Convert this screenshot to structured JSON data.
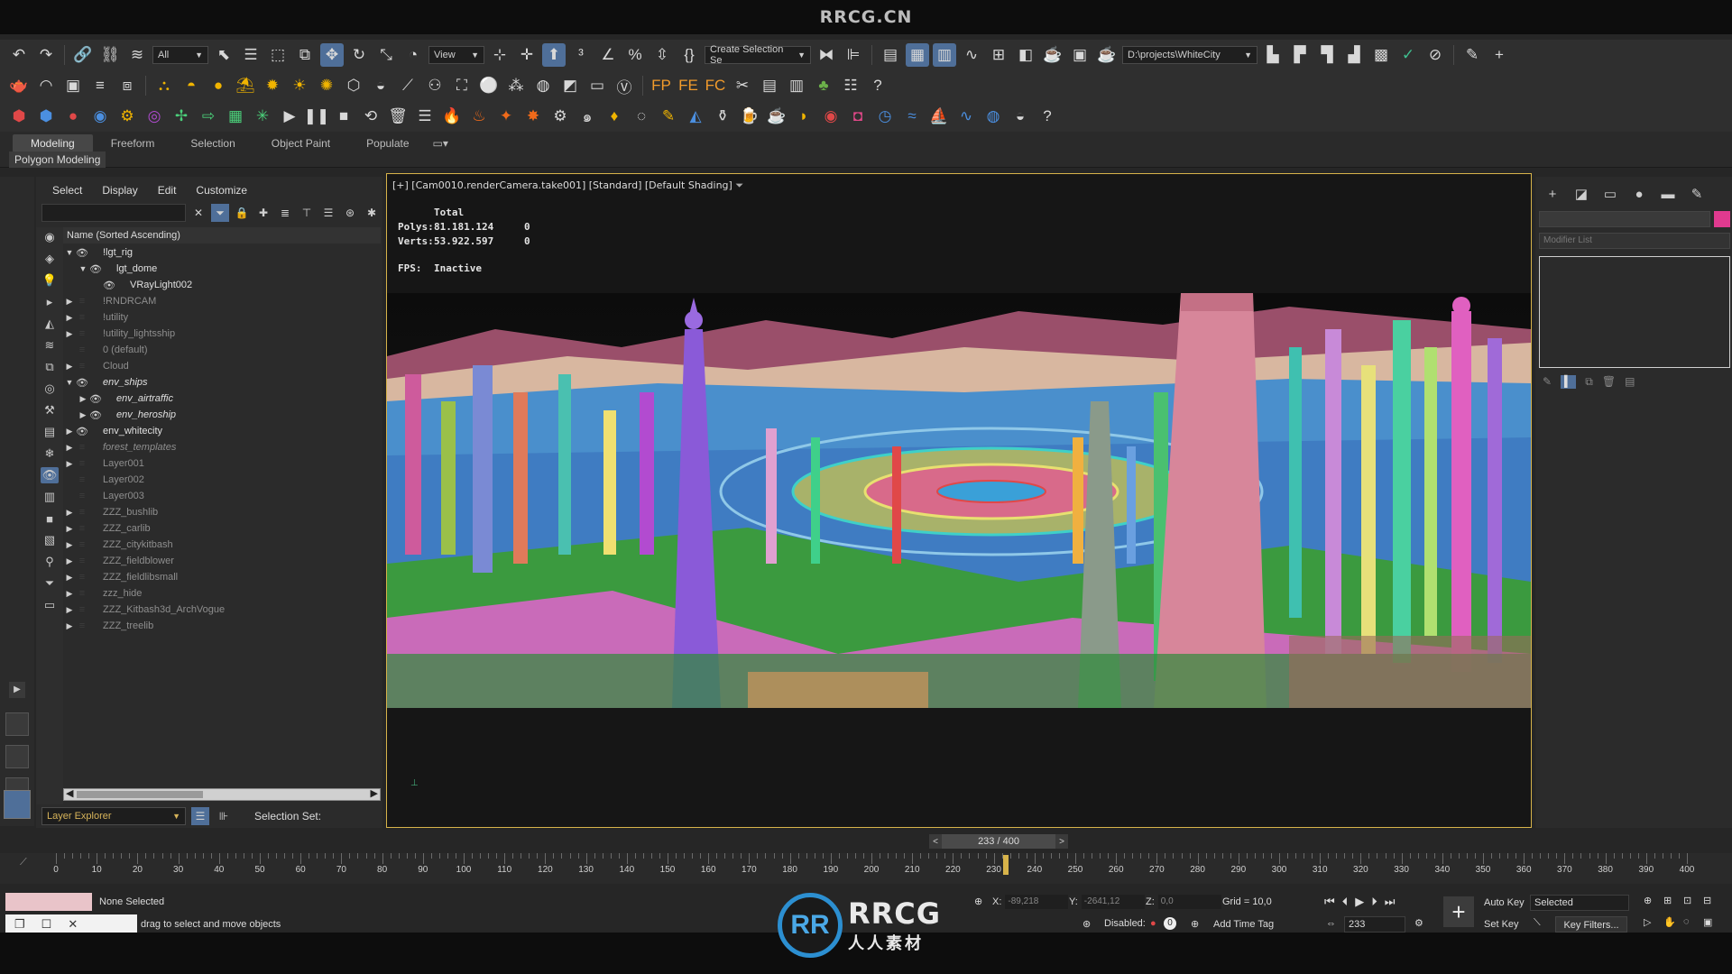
{
  "watermark": {
    "top": "RRCG.CN",
    "brand": "RRCG",
    "brand_cn": "人人素材",
    "logo_letters": "RR"
  },
  "toolbar1": {
    "filter_value": "All",
    "view_value": "View",
    "selection_set_placeholder": "Create Selection Se",
    "project_path": "D:\\projects\\WhiteCity"
  },
  "ribbon": {
    "tabs": [
      "Modeling",
      "Freeform",
      "Selection",
      "Object Paint",
      "Populate"
    ],
    "subpanel": "Polygon Modeling"
  },
  "explorer": {
    "menu": [
      "Select",
      "Display",
      "Edit",
      "Customize"
    ],
    "column_header": "Name (Sorted Ascending)",
    "layers": [
      {
        "name": "!lgt_rig",
        "lit": true,
        "italic": false,
        "indent": 0,
        "expanded": true,
        "eye": true
      },
      {
        "name": "lgt_dome",
        "lit": true,
        "italic": false,
        "indent": 1,
        "expanded": true,
        "eye": true
      },
      {
        "name": "VRayLight002",
        "lit": true,
        "italic": false,
        "indent": 2,
        "expanded": null,
        "eye": true
      },
      {
        "name": "!RNDRCAM",
        "lit": false,
        "italic": false,
        "indent": 0,
        "expanded": false,
        "eye": false
      },
      {
        "name": "!utility",
        "lit": false,
        "italic": false,
        "indent": 0,
        "expanded": false,
        "eye": false
      },
      {
        "name": "!utility_lightsship",
        "lit": false,
        "italic": false,
        "indent": 0,
        "expanded": false,
        "eye": false
      },
      {
        "name": "0 (default)",
        "lit": false,
        "italic": false,
        "indent": 0,
        "expanded": null,
        "eye": false
      },
      {
        "name": "Cloud",
        "lit": false,
        "italic": false,
        "indent": 0,
        "expanded": false,
        "eye": false
      },
      {
        "name": "env_ships",
        "lit": true,
        "italic": true,
        "indent": 0,
        "expanded": true,
        "eye": true
      },
      {
        "name": "env_airtraffic",
        "lit": true,
        "italic": true,
        "indent": 1,
        "expanded": false,
        "eye": true
      },
      {
        "name": "env_heroship",
        "lit": true,
        "italic": true,
        "indent": 1,
        "expanded": false,
        "eye": true
      },
      {
        "name": "env_whitecity",
        "lit": true,
        "italic": false,
        "indent": 0,
        "expanded": false,
        "eye": true
      },
      {
        "name": "forest_templates",
        "lit": false,
        "italic": true,
        "indent": 0,
        "expanded": false,
        "eye": false
      },
      {
        "name": "Layer001",
        "lit": false,
        "italic": false,
        "indent": 0,
        "expanded": false,
        "eye": false
      },
      {
        "name": "Layer002",
        "lit": false,
        "italic": false,
        "indent": 0,
        "expanded": null,
        "eye": false
      },
      {
        "name": "Layer003",
        "lit": false,
        "italic": false,
        "indent": 0,
        "expanded": null,
        "eye": false
      },
      {
        "name": "ZZZ_bushlib",
        "lit": false,
        "italic": false,
        "indent": 0,
        "expanded": false,
        "eye": false
      },
      {
        "name": "ZZZ_carlib",
        "lit": false,
        "italic": false,
        "indent": 0,
        "expanded": false,
        "eye": false
      },
      {
        "name": "ZZZ_citykitbash",
        "lit": false,
        "italic": false,
        "indent": 0,
        "expanded": false,
        "eye": false
      },
      {
        "name": "ZZZ_fieldblower",
        "lit": false,
        "italic": false,
        "indent": 0,
        "expanded": false,
        "eye": false
      },
      {
        "name": "ZZZ_fieldlibsmall",
        "lit": false,
        "italic": false,
        "indent": 0,
        "expanded": false,
        "eye": false
      },
      {
        "name": "zzz_hide",
        "lit": false,
        "italic": false,
        "indent": 0,
        "expanded": false,
        "eye": false
      },
      {
        "name": "ZZZ_Kitbash3d_ArchVogue",
        "lit": false,
        "italic": false,
        "indent": 0,
        "expanded": false,
        "eye": false
      },
      {
        "name": "ZZZ_treelib",
        "lit": false,
        "italic": false,
        "indent": 0,
        "expanded": false,
        "eye": false
      }
    ],
    "explorer_type": "Layer Explorer",
    "selection_set_label": "Selection Set:"
  },
  "viewport": {
    "label": "[+] [Cam0010.renderCamera.take001] [Standard] [Default Shading]",
    "stats_header": "Total",
    "polys_label": "Polys:",
    "polys_total": "81.181.124",
    "polys_sel": "0",
    "verts_label": "Verts:",
    "verts_total": "53.922.597",
    "verts_sel": "0",
    "fps_label": "FPS:",
    "fps_value": "Inactive"
  },
  "command_panel": {
    "modifier_list": "Modifier List",
    "swatch_color": "#e03a8f"
  },
  "time": {
    "frame_display": "233 / 400",
    "current_frame": 233,
    "total_frames": 400,
    "tick_labels": [
      "0",
      "10",
      "20",
      "30",
      "40",
      "50",
      "60",
      "70",
      "80",
      "90",
      "100",
      "110",
      "120",
      "130",
      "140",
      "150",
      "160",
      "170",
      "180",
      "190",
      "200",
      "210",
      "220",
      "230",
      "240",
      "250",
      "260",
      "270",
      "280",
      "290",
      "300",
      "310",
      "320",
      "330",
      "340",
      "350",
      "360",
      "370",
      "380",
      "390",
      "400"
    ]
  },
  "status": {
    "selection": "None Selected",
    "prompt": "drag to select and move objects",
    "x_label": "X:",
    "x_value": "-89,218",
    "y_label": "Y:",
    "y_value": "-2641,12",
    "z_label": "Z:",
    "z_value": "0,0",
    "grid": "Grid = 10,0",
    "disabled_label": "Disabled:",
    "add_time_tag": "Add Time Tag",
    "auto_key": "Auto Key",
    "key_mode": "Selected",
    "set_key": "Set Key",
    "key_filters": "Key Filters...",
    "frame_field": "233"
  }
}
